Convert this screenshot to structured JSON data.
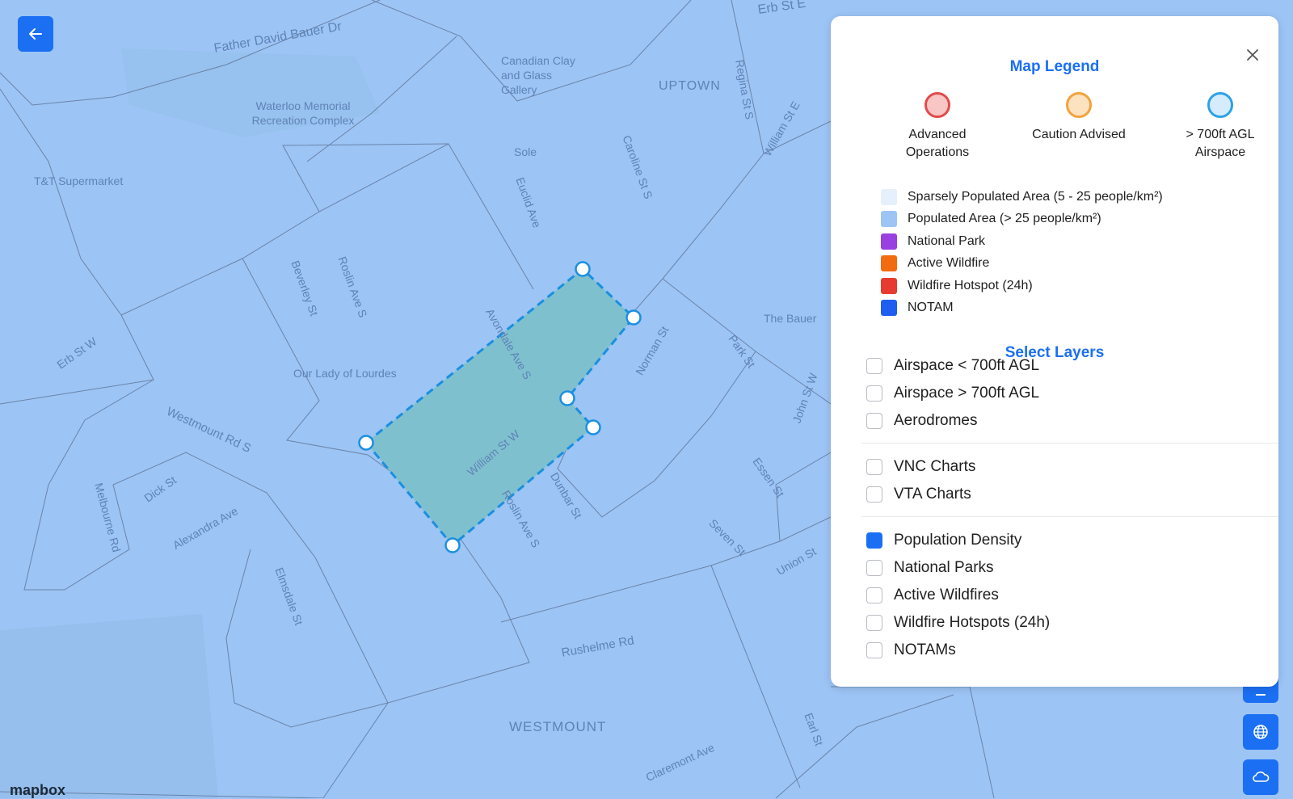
{
  "map": {
    "street_labels": [
      {
        "name": "Father David Bauer Dr"
      },
      {
        "name": "Erb St E"
      },
      {
        "name": "Canadian Clay and Glass Gallery"
      },
      {
        "name": "UPTOWN"
      },
      {
        "name": "Waterloo Memorial Recreation Complex"
      },
      {
        "name": "T&T Supermarket"
      },
      {
        "name": "Caroline St S"
      },
      {
        "name": "Euclid Ave"
      },
      {
        "name": "Regina St S"
      },
      {
        "name": "William St E"
      },
      {
        "name": "Beverley St"
      },
      {
        "name": "Roslin Ave S"
      },
      {
        "name": "Our Lady of Lourdes"
      },
      {
        "name": "Erb St W"
      },
      {
        "name": "Westmount Rd S"
      },
      {
        "name": "Avondale Ave S"
      },
      {
        "name": "William St W"
      },
      {
        "name": "Norman St"
      },
      {
        "name": "Park St"
      },
      {
        "name": "The Bauer"
      },
      {
        "name": "Melbourne Rd"
      },
      {
        "name": "Alexandra Ave"
      },
      {
        "name": "Dick St"
      },
      {
        "name": "Elmsdale St"
      },
      {
        "name": "Rushelme Rd"
      },
      {
        "name": "WESTMOUNT"
      },
      {
        "name": "Claremont Ave"
      },
      {
        "name": "Seven St"
      },
      {
        "name": "Essen St"
      },
      {
        "name": "Union St"
      },
      {
        "name": "John St W"
      },
      {
        "name": "Earl St"
      },
      {
        "name": "Sole"
      },
      {
        "name": "Roslin Ave S"
      },
      {
        "name": "Dunbar St"
      }
    ],
    "attribution": "mapbox"
  },
  "back_button": {
    "icon": "arrow-left-icon"
  },
  "side_buttons": [
    {
      "icon": "menu-icon"
    },
    {
      "icon": "globe-icon"
    },
    {
      "icon": "cloud-icon"
    }
  ],
  "legend": {
    "title": "Map Legend",
    "close_icon": "close-icon",
    "circles": [
      {
        "label": "Advanced Operations",
        "fill": "#f9c6c6",
        "stroke": "#e24b4b"
      },
      {
        "label": "Caution Advised",
        "fill": "#fde2bf",
        "stroke": "#f3a23c"
      },
      {
        "label": "> 700ft AGL Airspace",
        "fill": "#d4ecfb",
        "stroke": "#2ea2e6"
      }
    ],
    "items": [
      {
        "label": "Sparsely Populated Area (5 - 25 people/km²)",
        "color": "#e6effc"
      },
      {
        "label": "Populated Area (> 25 people/km²)",
        "color": "#9cc4f5"
      },
      {
        "label": "National Park",
        "color": "#9a3fe0"
      },
      {
        "label": "Active Wildfire",
        "color": "#f26b11"
      },
      {
        "label": "Wildfire Hotspot (24h)",
        "color": "#e63b2e"
      },
      {
        "label": "NOTAM",
        "color": "#1e5ef0"
      }
    ]
  },
  "layers": {
    "title": "Select Layers",
    "groups": [
      [
        {
          "label": "Airspace < 700ft AGL",
          "checked": false
        },
        {
          "label": "Airspace > 700ft AGL",
          "checked": false
        },
        {
          "label": "Aerodromes",
          "checked": false
        }
      ],
      [
        {
          "label": "VNC Charts",
          "checked": false
        },
        {
          "label": "VTA Charts",
          "checked": false
        }
      ],
      [
        {
          "label": "Population Density",
          "checked": true
        },
        {
          "label": "National Parks",
          "checked": false
        },
        {
          "label": "Active Wildfires",
          "checked": false
        },
        {
          "label": "Wildfire Hotspots (24h)",
          "checked": false
        },
        {
          "label": "NOTAMs",
          "checked": false
        }
      ]
    ]
  },
  "colors": {
    "accent": "#1b6ff3",
    "map_fill": "#9cc4f5",
    "polygon_fill": "#7fc0cf",
    "polygon_stroke": "#1b8fe0"
  }
}
